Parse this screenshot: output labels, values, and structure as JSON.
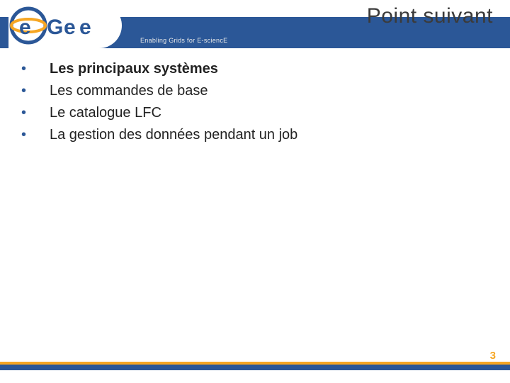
{
  "brand": {
    "name": "egee",
    "tagline": "Enabling Grids for E-sciencE"
  },
  "title": "Point suivant",
  "bullets": [
    {
      "text": "Les principaux systèmes",
      "bold": true
    },
    {
      "text": "Les commandes de base",
      "bold": false
    },
    {
      "text": "Le catalogue LFC",
      "bold": false
    },
    {
      "text": "La gestion des données pendant un job",
      "bold": false
    }
  ],
  "page_number": "3",
  "colors": {
    "brand_blue": "#2b5797",
    "accent_orange": "#f6a623"
  }
}
